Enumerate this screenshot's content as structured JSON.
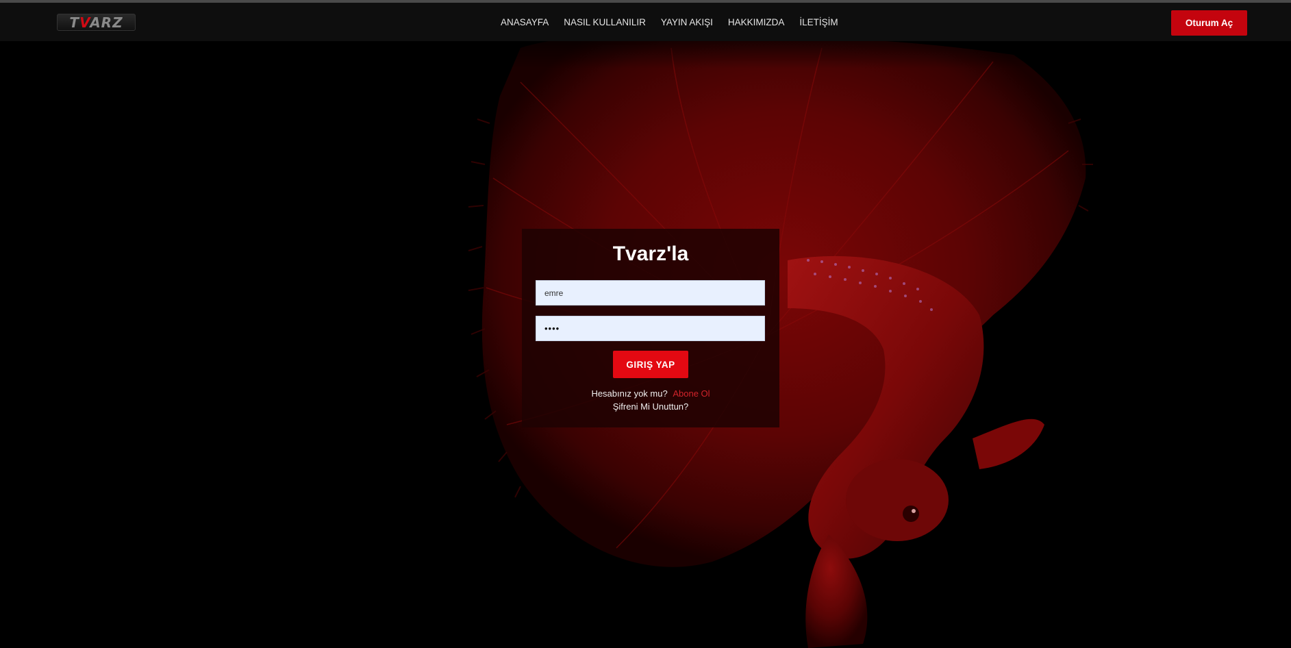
{
  "header": {
    "logo": {
      "text_part1": "T",
      "text_accent": "V",
      "text_part2": "ARZ"
    },
    "nav_items": [
      "ANASAYFA",
      "NASIL KULLANILIR",
      "YAYIN AKIŞI",
      "HAKKIMIZDA",
      "İLETİŞİM"
    ],
    "signin_label": "Oturum Aç"
  },
  "login": {
    "title": "Tvarz'la",
    "username_value": "emre",
    "password_value": "••••",
    "submit_label": "GIRIŞ YAP",
    "no_account_text": "Hesabınız yok mu?",
    "subscribe_link": "Abone Ol",
    "forgot_link": "Şifreni Mi Unuttun?"
  },
  "colors": {
    "accent": "#c4040e",
    "button_red": "#e30912",
    "link_red": "#d2232a",
    "background": "#000000",
    "navbar": "#0e0e0e",
    "input_bg": "#e8f0fe"
  },
  "background_image": {
    "subject": "red betta fish on black background"
  }
}
